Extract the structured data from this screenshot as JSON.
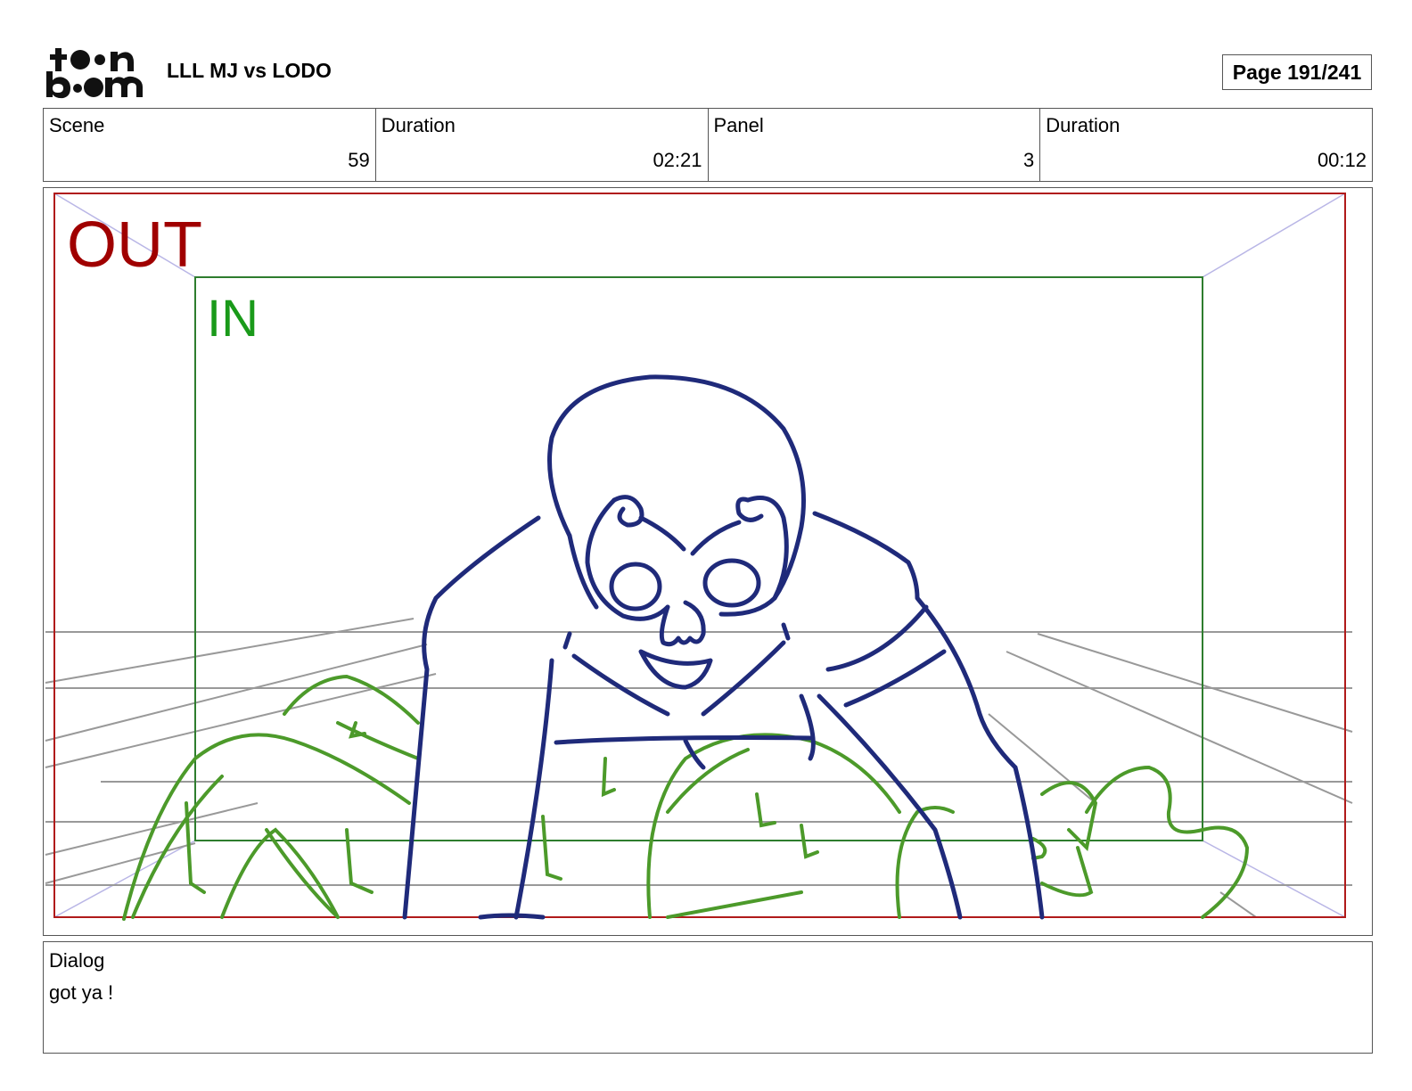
{
  "header": {
    "logo_text": "toon boom",
    "project_title": "LLL MJ vs LODO",
    "page_label": "Page 191/241"
  },
  "info": [
    {
      "label": "Scene",
      "value": "59"
    },
    {
      "label": "Duration",
      "value": "02:21"
    },
    {
      "label": "Panel",
      "value": "3"
    },
    {
      "label": "Duration",
      "value": "00:12"
    }
  ],
  "panel": {
    "out_label": "OUT",
    "in_label": "IN",
    "colors": {
      "out_frame": "#b01a1a",
      "in_frame": "#2e7d2e",
      "character": "#1f2a7a",
      "grass": "#4c9a2a",
      "perspective": "#999999"
    }
  },
  "dialog": {
    "label": "Dialog",
    "text": "got ya !"
  }
}
